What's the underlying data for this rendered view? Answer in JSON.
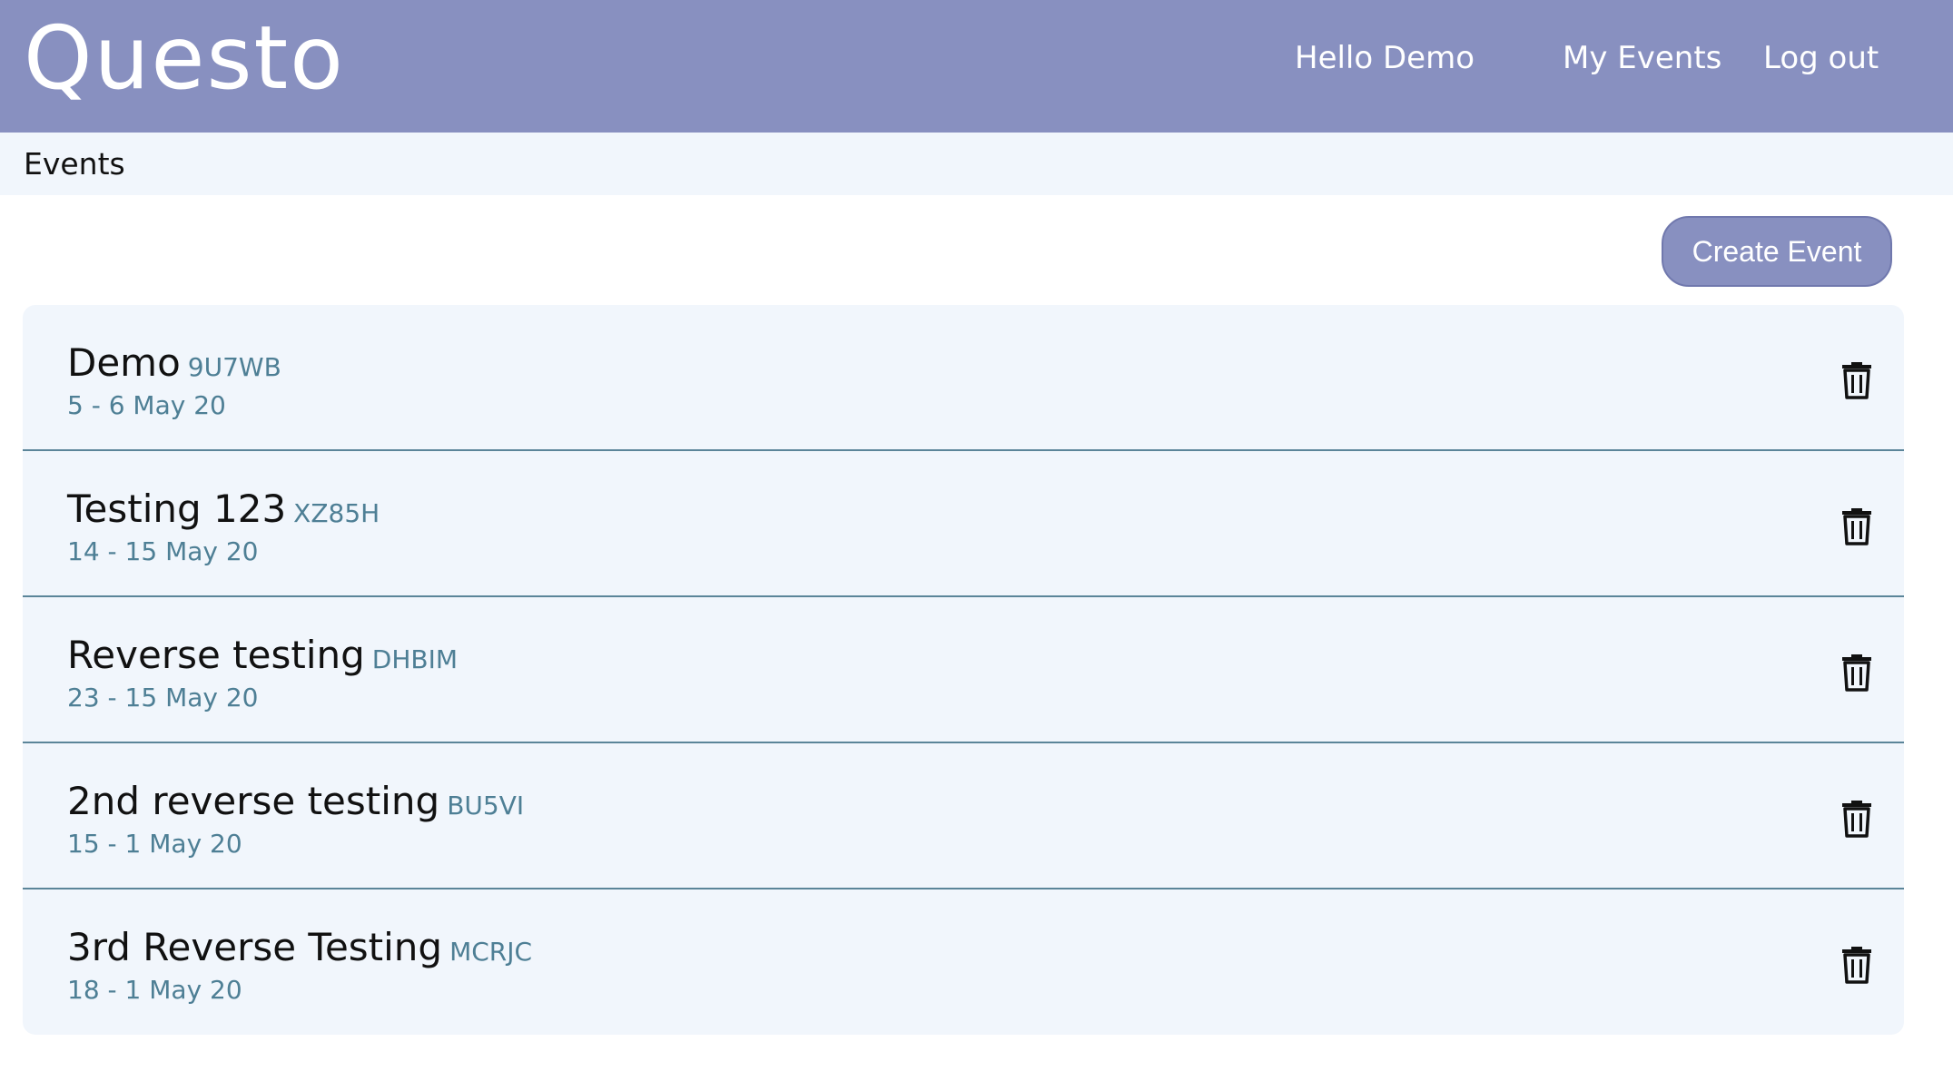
{
  "header": {
    "logo": "Questo",
    "greeting": "Hello Demo",
    "nav": {
      "my_events": "My Events",
      "log_out": "Log out"
    },
    "background_color": "#8890c0"
  },
  "breadcrumb": {
    "label": "Events"
  },
  "actions": {
    "create_event_label": "Create Event"
  },
  "events": [
    {
      "name": "Demo",
      "code": "9U7WB",
      "dates": "5 - 6 May 20",
      "delete_icon": "trash-icon"
    },
    {
      "name": "Testing 123",
      "code": "XZ85H",
      "dates": "14 - 15 May 20",
      "delete_icon": "trash-icon"
    },
    {
      "name": "Reverse testing",
      "code": "DHBIM",
      "dates": "23 - 15 May 20",
      "delete_icon": "trash-icon"
    },
    {
      "name": "2nd reverse testing",
      "code": "BU5VI",
      "dates": "15 - 1 May 20",
      "delete_icon": "trash-icon"
    },
    {
      "name": "3rd Reverse Testing",
      "code": "MCRJC",
      "dates": "18 - 1 May 20",
      "delete_icon": "trash-icon"
    }
  ],
  "colors": {
    "accent": "#8890c0",
    "row_background": "#f1f6fc",
    "secondary_text": "#4e7f95"
  }
}
